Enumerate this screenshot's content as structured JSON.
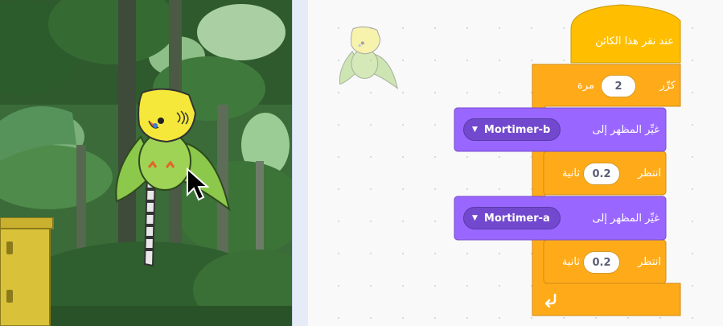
{
  "colors": {
    "events": "#ffbf00",
    "control": "#ffab19",
    "looks": "#9966ff"
  },
  "stage": {
    "sprite": "parakeet-sprite",
    "cursor": "mouse-pointer-icon"
  },
  "sprite_thumbnail": {
    "icon": "parakeet-thumbnail"
  },
  "script": {
    "hat": {
      "label": "عند نقر هذا الكائن"
    },
    "repeat": {
      "label_prefix": "كرِّر",
      "times": "2",
      "label_suffix": "مرة"
    },
    "switch1": {
      "label": "غيِّر المظهر إلى",
      "costume": "Mortimer-b"
    },
    "wait1": {
      "label": "انتظر",
      "seconds": "0.2",
      "unit": "ثانية"
    },
    "switch2": {
      "label": "غيِّر المظهر إلى",
      "costume": "Mortimer-a"
    },
    "wait2": {
      "label": "انتظر",
      "seconds": "0.2",
      "unit": "ثانية"
    },
    "repeat_end": {
      "icon": "loop-arrow-icon"
    }
  }
}
